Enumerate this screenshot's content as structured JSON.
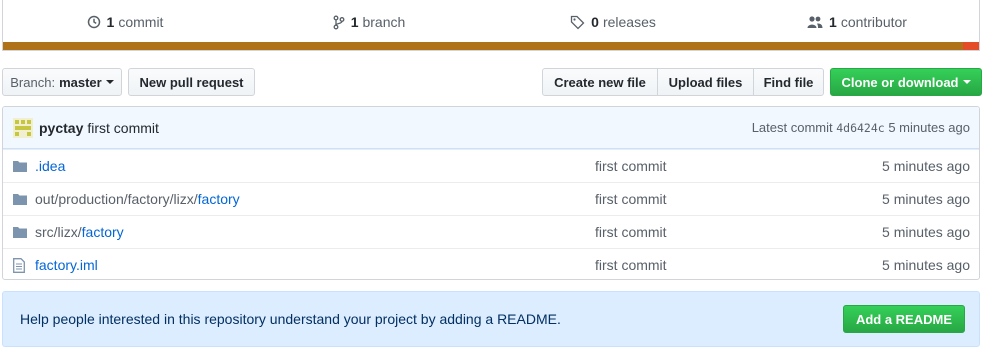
{
  "summary": {
    "commits": {
      "count": "1",
      "label": "commit"
    },
    "branches": {
      "count": "1",
      "label": "branch"
    },
    "releases": {
      "count": "0",
      "label": "releases"
    },
    "contributors": {
      "count": "1",
      "label": "contributor"
    }
  },
  "language_bar": {
    "colors": [
      "#b07219",
      "#e34c26"
    ]
  },
  "toolbar": {
    "branch_label": "Branch:",
    "branch_value": "master",
    "new_pull_request": "New pull request",
    "create_new_file": "Create new file",
    "upload_files": "Upload files",
    "find_file": "Find file",
    "clone_or_download": "Clone or download"
  },
  "commit_tease": {
    "author": "pyctay",
    "message": "first commit",
    "latest_label": "Latest commit",
    "sha": "4d6424c",
    "age": "5 minutes ago"
  },
  "files": [
    {
      "type": "folder",
      "path_prefix": "",
      "name": ".idea",
      "message": "first commit",
      "age": "5 minutes ago"
    },
    {
      "type": "folder",
      "path_prefix": "out/production/factory/lizx/",
      "name": "factory",
      "message": "first commit",
      "age": "5 minutes ago"
    },
    {
      "type": "folder",
      "path_prefix": "src/lizx/",
      "name": "factory",
      "message": "first commit",
      "age": "5 minutes ago"
    },
    {
      "type": "file",
      "path_prefix": "",
      "name": "factory.iml",
      "message": "first commit",
      "age": "5 minutes ago"
    }
  ],
  "readme_prompt": {
    "text": "Help people interested in this repository understand your project by adding a README.",
    "button": "Add a README"
  },
  "colors": {
    "link": "#0366d6",
    "green_button": "#28a745",
    "java": "#b07219",
    "html": "#e34c26"
  }
}
